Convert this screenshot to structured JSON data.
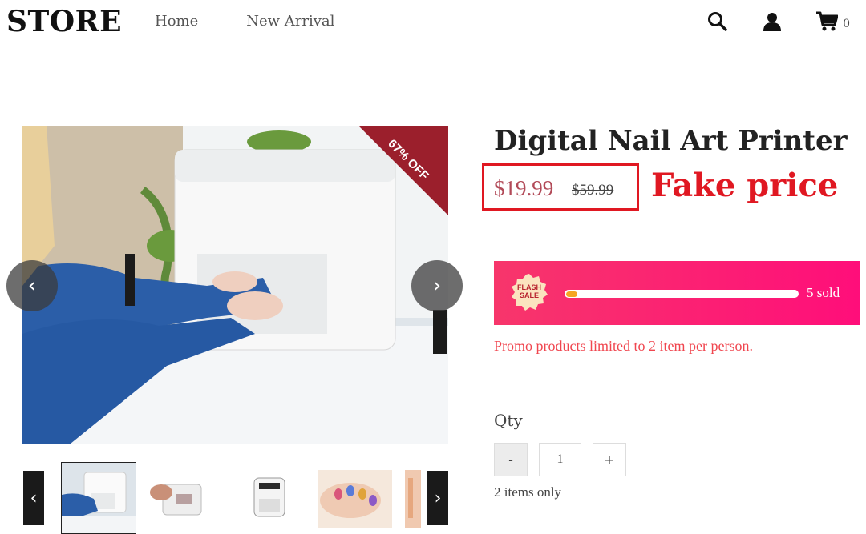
{
  "header": {
    "logo": "STORE",
    "nav": [
      "Home",
      "New Arrival"
    ],
    "icons": [
      "search-icon",
      "user-icon",
      "cart-icon"
    ],
    "cart_count": "0"
  },
  "gallery": {
    "discount_ribbon": "67% OFF",
    "prev_arrow": "‹",
    "next_arrow": "›",
    "thumb_prev": "‹",
    "thumb_next": "›",
    "thumbnails": [
      "thumb-1",
      "thumb-2",
      "thumb-3",
      "thumb-4",
      "thumb-5"
    ]
  },
  "product": {
    "title": "Digital Nail Art Printer",
    "price": "$19.99",
    "old_price": "$59.99",
    "annotation": "Fake price"
  },
  "flash_sale": {
    "badge_line1": "FLASH",
    "badge_line2": "SALE",
    "sold_text": "5 sold",
    "progress": 0.05
  },
  "promo_text": "Promo products limited to 2 item per person.",
  "quantity": {
    "label": "Qty",
    "minus": "-",
    "value": "1",
    "plus": "+",
    "stock_text": "2 items only"
  },
  "colors": {
    "accent_red": "#e01822",
    "flash_gradient_start": "#f7366b",
    "flash_gradient_end": "#ff0e7a",
    "ribbon": "#9b1f2c"
  }
}
